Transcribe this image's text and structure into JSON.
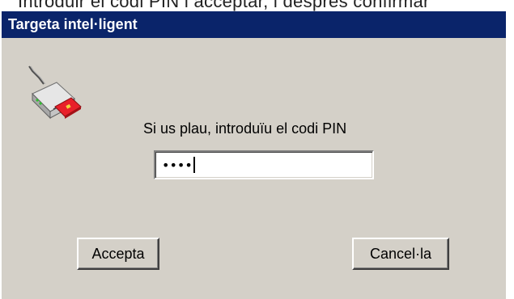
{
  "background": {
    "partial_text": "Introduir el codi PIN i acceptar, i després confirmar"
  },
  "dialog": {
    "title": "Targeta intel·ligent",
    "prompt": "Si us plau, introduïu el codi PIN",
    "pin_field": {
      "value_masked": "••••"
    },
    "buttons": {
      "ok_label": "Accepta",
      "cancel_label": "Cancel·la"
    },
    "icon": "smart-card-reader-icon"
  },
  "colors": {
    "titlebar": "#0a246a",
    "dialog_bg": "#d4d0c8",
    "card_red": "#e8202a"
  }
}
